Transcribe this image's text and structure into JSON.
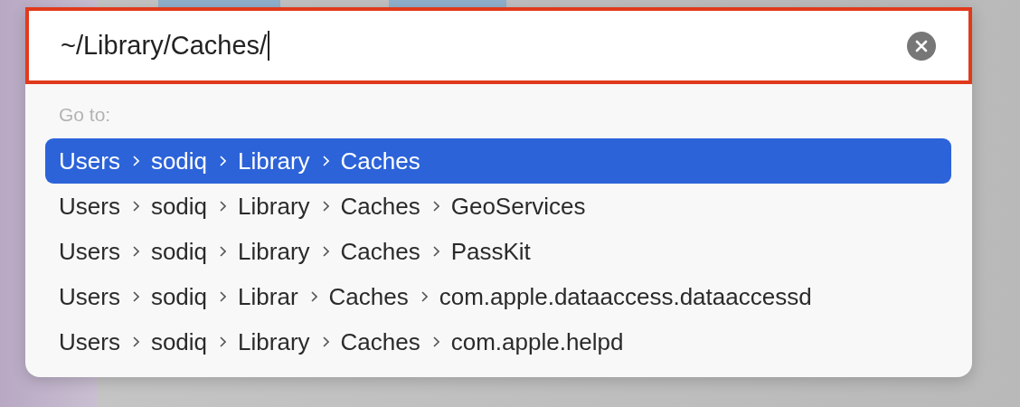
{
  "field": {
    "value": "~/Library/Caches/",
    "focused": true
  },
  "section_label": "Go to:",
  "suggestions": [
    {
      "segments": [
        "Users",
        "sodiq",
        "Library",
        "Caches"
      ],
      "selected": true
    },
    {
      "segments": [
        "Users",
        "sodiq",
        "Library",
        "Caches",
        "GeoServices"
      ],
      "selected": false
    },
    {
      "segments": [
        "Users",
        "sodiq",
        "Library",
        "Caches",
        "PassKit"
      ],
      "selected": false
    },
    {
      "segments": [
        "Users",
        "sodiq",
        "Librar",
        "Caches",
        "com.apple.dataaccess.dataaccessd"
      ],
      "selected": false
    },
    {
      "segments": [
        "Users",
        "sodiq",
        "Library",
        "Caches",
        "com.apple.helpd"
      ],
      "selected": false
    }
  ]
}
